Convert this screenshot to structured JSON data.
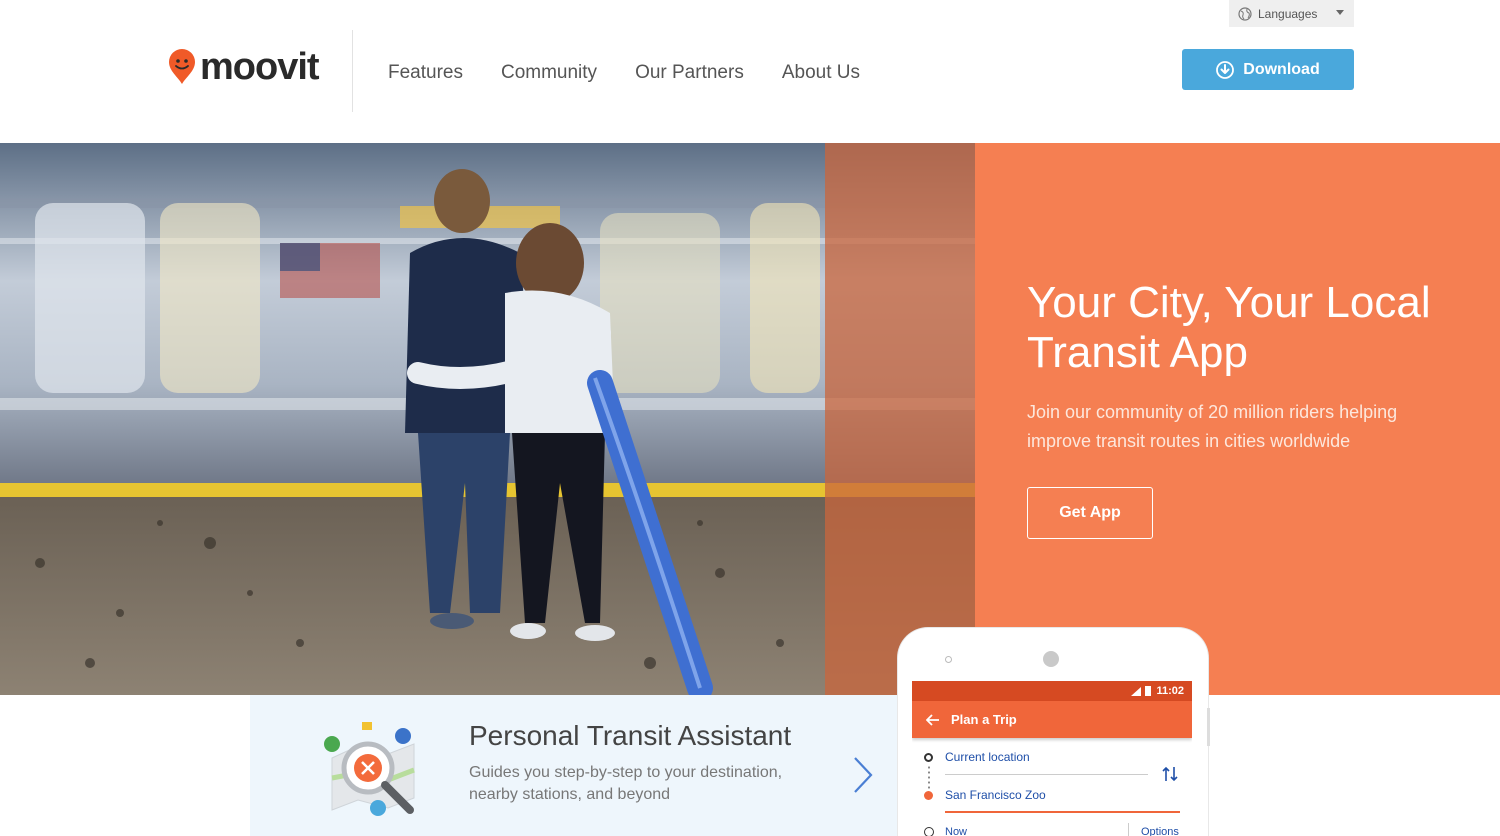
{
  "header": {
    "languages_label": "Languages",
    "logo_text": "moovit",
    "nav": [
      {
        "label": "Features"
      },
      {
        "label": "Community"
      },
      {
        "label": "Our Partners"
      },
      {
        "label": "About Us"
      }
    ],
    "download_label": "Download"
  },
  "hero": {
    "title": "Your City, Your Local Transit App",
    "subtitle": "Join our community of 20 million riders helping improve transit routes in cities worldwide",
    "cta_label": "Get App"
  },
  "feature": {
    "title": "Personal Transit Assistant",
    "description": "Guides you step-by-step to your destination, nearby stations, and beyond"
  },
  "phone": {
    "time": "11:02",
    "screen_title": "Plan a Trip",
    "from": "Current location",
    "to": "San Francisco Zoo",
    "when": "Now",
    "options": "Options"
  },
  "colors": {
    "brand_orange": "#f57f52",
    "download_blue": "#4aa8dc",
    "app_orange": "#f0663a"
  }
}
